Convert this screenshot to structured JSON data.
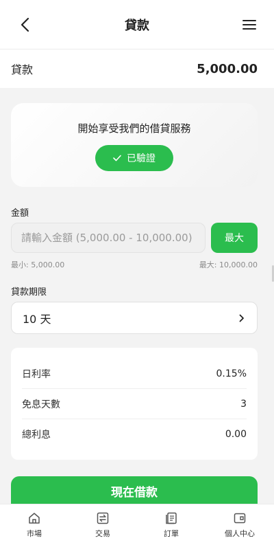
{
  "header": {
    "title": "貸款",
    "back_icon": "chevron-left-icon",
    "menu_icon": "hamburger-menu-icon"
  },
  "loan_summary": {
    "label": "貸款",
    "value": "5,000.00"
  },
  "service_card": {
    "title": "開始享受我們的借貸服務",
    "verified_label": "已驗證",
    "verified_icon": "check-icon"
  },
  "amount": {
    "label": "金額",
    "placeholder": "請輸入金額 (5,000.00 - 10,000.00)",
    "value": "",
    "max_button": "最大",
    "min_hint": "最小: 5,000.00",
    "max_hint": "最大: 10,000.00"
  },
  "term": {
    "label": "貸款期限",
    "selected": "10 天",
    "chevron_icon": "chevron-right-icon"
  },
  "rates": [
    {
      "label": "日利率",
      "value": "0.15%"
    },
    {
      "label": "免息天數",
      "value": "3"
    },
    {
      "label": "總利息",
      "value": "0.00"
    }
  ],
  "submit_button": "現在借款",
  "tabbar": [
    {
      "label": "市場",
      "icon": "home-icon"
    },
    {
      "label": "交易",
      "icon": "exchange-icon"
    },
    {
      "label": "訂單",
      "icon": "orders-icon"
    },
    {
      "label": "個人中心",
      "icon": "wallet-icon"
    }
  ],
  "colors": {
    "accent": "#2bbd4e",
    "background": "#f3f3f3"
  }
}
